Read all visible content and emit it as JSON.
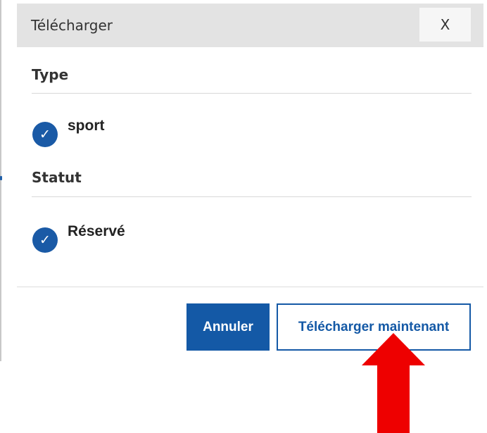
{
  "dialog": {
    "title": "Télécharger",
    "close_label": "X",
    "sections": [
      {
        "title": "Type",
        "options": [
          {
            "label": "sport",
            "checked": true
          }
        ]
      },
      {
        "title": "Statut",
        "options": [
          {
            "label": "Réservé",
            "checked": true
          }
        ]
      }
    ],
    "cancel_label": "Annuler",
    "download_label": "Télécharger maintenant"
  },
  "icons": {
    "check": "checkmark-icon",
    "close": "close-icon",
    "arrow": "arrow-up-icon"
  },
  "colors": {
    "accent": "#1459a6",
    "header_bg": "#e3e3e3",
    "arrow": "#ee0000"
  }
}
